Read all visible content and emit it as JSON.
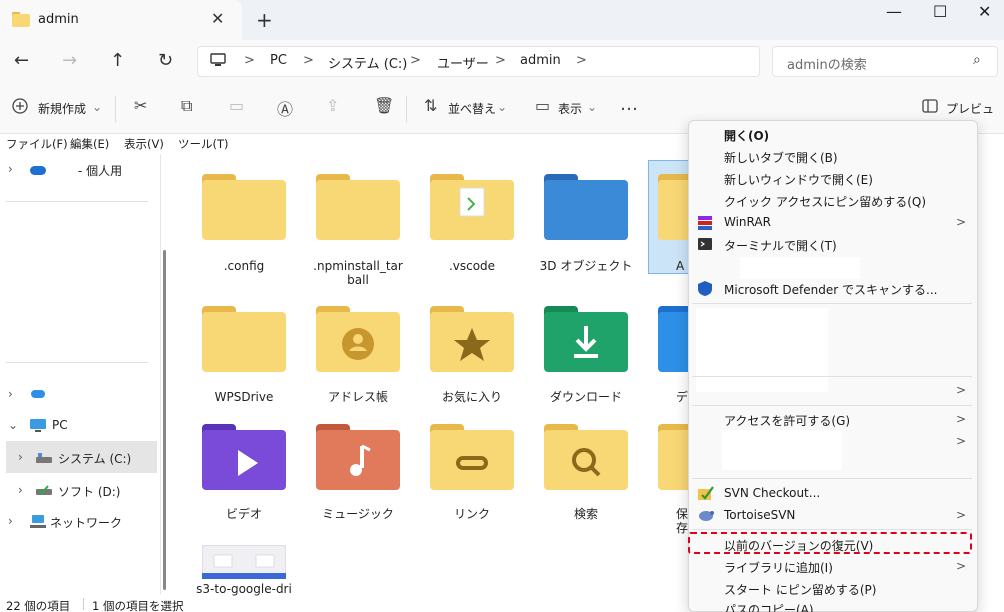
{
  "window": {
    "tab_title": "admin",
    "tab_close": "✕",
    "new_tab": "+",
    "minimize": "—",
    "maximize": "☐",
    "close": "✕"
  },
  "address_bar": {
    "breadcrumb": [
      "PC",
      "システム (C:)",
      "ユーザー",
      "admin"
    ],
    "separator": ">",
    "search_placeholder": "adminの検索"
  },
  "toolbar": {
    "new_label": "新規作成",
    "sort_label": "並べ替え",
    "view_label": "表示",
    "more_label": "…",
    "preview_label": "プレビュー"
  },
  "menubar": [
    "ファイル(F)",
    "編集(E)",
    "表示(V)",
    "ツール(T)"
  ],
  "nav_pane": {
    "personal": "- 個人用",
    "pc": "PC",
    "system_drive": "システム (C:)",
    "soft_drive": "ソフト (D:)",
    "network": "ネットワーク"
  },
  "files": [
    {
      "name": ".config",
      "type": "plain"
    },
    {
      "name": ".npminstall_tarball",
      "type": "plain"
    },
    {
      "name": ".vscode",
      "type": "vscode"
    },
    {
      "name": "3D オブジェクト",
      "type": "3d"
    },
    {
      "name": "A",
      "type": "plain"
    },
    {
      "name": "WPSDrive",
      "type": "plain"
    },
    {
      "name": "アドレス帳",
      "type": "contacts"
    },
    {
      "name": "お気に入り",
      "type": "favorites"
    },
    {
      "name": "ダウンロード",
      "type": "downloads"
    },
    {
      "name": "デ",
      "type": "desktop"
    },
    {
      "name": "ビデオ",
      "type": "videos"
    },
    {
      "name": "ミュージック",
      "type": "music"
    },
    {
      "name": "リンク",
      "type": "links"
    },
    {
      "name": "検索",
      "type": "searches"
    },
    {
      "name": "保存",
      "type": "saved"
    },
    {
      "name": "s3-to-google-dri",
      "type": "thumbnail"
    }
  ],
  "status": {
    "count": "22 個の項目",
    "selected": "1 個の項目を選択"
  },
  "context_menu": {
    "open": "開く(O)",
    "open_new_tab": "新しいタブで開く(B)",
    "open_new_window": "新しいウィンドウで開く(E)",
    "pin_quick": "クイック アクセスにピン留めする(Q)",
    "winrar": "WinRAR",
    "terminal": "ターミナルで開く(T)",
    "defender": "Microsoft Defender でスキャンする...",
    "give_access": "アクセスを許可する(G)",
    "svn_checkout": "SVN Checkout...",
    "tortoise": "TortoiseSVN",
    "restore": "以前のバージョンの復元(V)",
    "library": "ライブラリに追加(I)",
    "pin_start": "スタート にピン留めする(P)",
    "copy_path": "パスのコピー(A)",
    "arrow": ">"
  },
  "colors": {
    "folder_back": "#e8b94a",
    "folder_body": "#f8d775",
    "highlight": "#e0001b"
  }
}
